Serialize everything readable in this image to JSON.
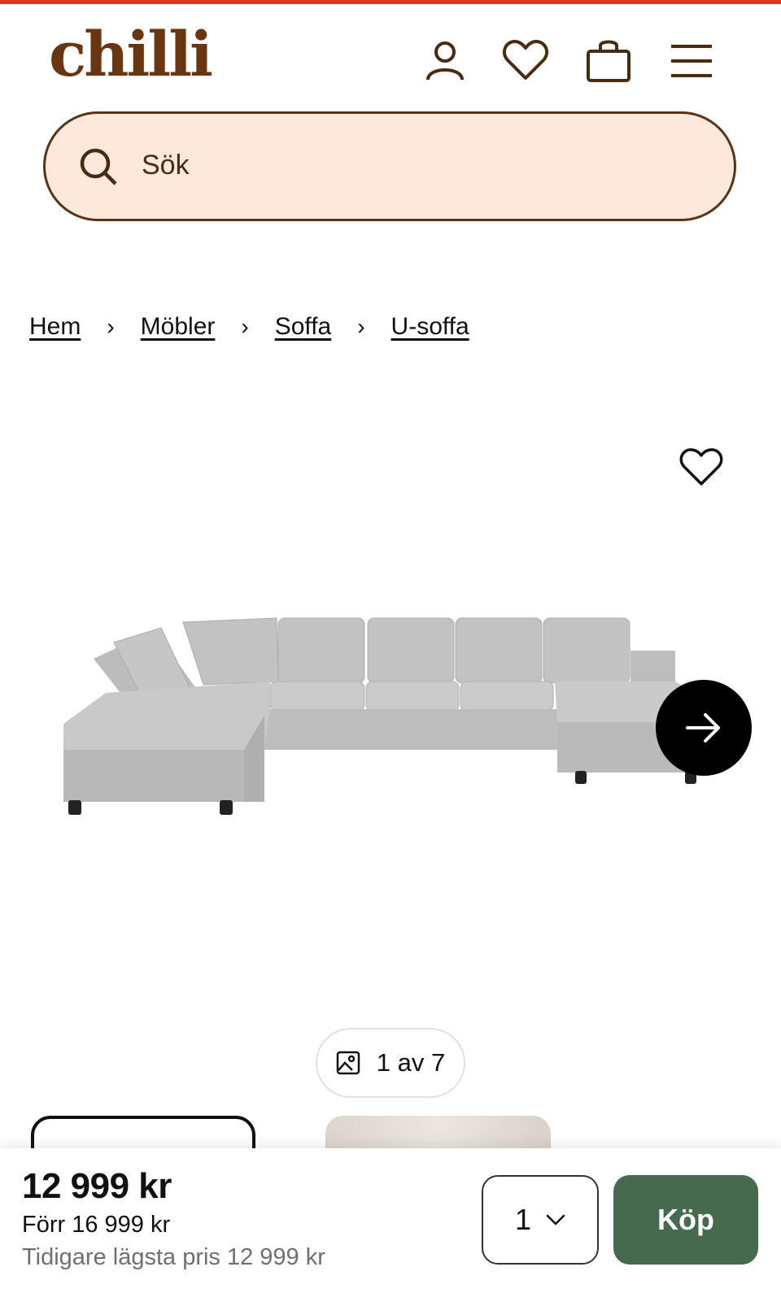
{
  "brand": {
    "logo_text": "chilli",
    "accent": "#e0341e",
    "brand_brown": "#6a3612"
  },
  "header": {
    "icons": [
      "account-icon",
      "heart-icon",
      "cart-icon",
      "menu-icon"
    ]
  },
  "search": {
    "placeholder": "Sök"
  },
  "breadcrumb": [
    {
      "label": "Hem"
    },
    {
      "label": "Möbler"
    },
    {
      "label": "Soffa"
    },
    {
      "label": "U-soffa"
    }
  ],
  "gallery": {
    "counter": "1 av 7",
    "image_alt": "U-soffa i ljusgrått tyg"
  },
  "purchase": {
    "price": "12 999 kr",
    "previous_price": "Förr 16 999 kr",
    "lowest_price": "Tidigare lägsta pris 12 999 kr",
    "quantity": "1",
    "buy_label": "Köp",
    "buy_color": "#466a4d"
  }
}
